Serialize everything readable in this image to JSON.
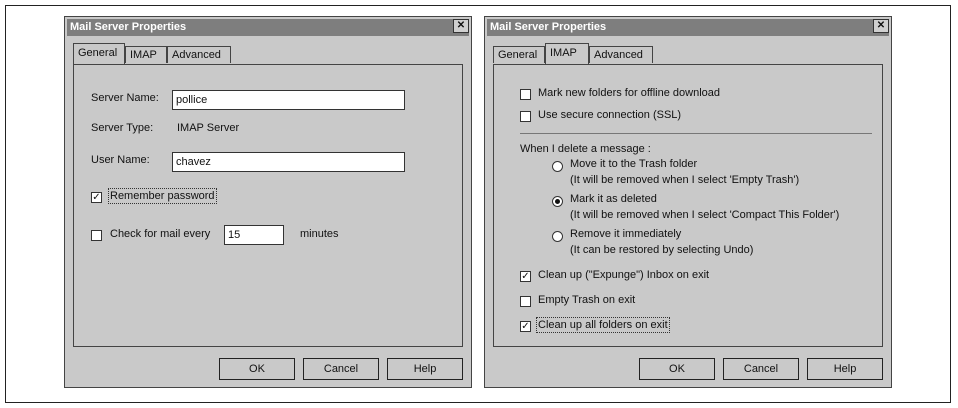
{
  "dialog_left": {
    "title": "Mail Server Properties",
    "close_glyph": "✕",
    "tabs": [
      "General",
      "IMAP",
      "Advanced"
    ],
    "server_name_label": "Server Name:",
    "server_name_value": "pollice",
    "server_type_label": "Server Type:",
    "server_type_value": "IMAP Server",
    "user_name_label": "User Name:",
    "user_name_value": "chavez",
    "remember_password_label": "Remember password",
    "remember_password_checked": true,
    "check_mail_label": "Check for mail every",
    "check_mail_checked": false,
    "check_mail_minutes": "15",
    "minutes_label": "minutes",
    "buttons": {
      "ok": "OK",
      "cancel": "Cancel",
      "help": "Help"
    }
  },
  "dialog_right": {
    "title": "Mail Server Properties",
    "close_glyph": "✕",
    "tabs": [
      "General",
      "IMAP",
      "Advanced"
    ],
    "mark_offline_label": "Mark new folders for offline download",
    "mark_offline_checked": false,
    "ssl_label": "Use secure connection (SSL)",
    "ssl_checked": false,
    "delete_heading": "When I delete a message :",
    "radio_trash_label": "Move it to the Trash folder",
    "radio_trash_note": "(It will be removed when I select 'Empty Trash')",
    "radio_mark_label": "Mark it as deleted",
    "radio_mark_note": "(It will be removed when I select 'Compact This Folder')",
    "radio_remove_label": "Remove it immediately",
    "radio_remove_note": "(It can be restored by selecting Undo)",
    "selected_radio": "mark",
    "expunge_label": "Clean up (\"Expunge\") Inbox on exit",
    "expunge_checked": true,
    "empty_trash_label": "Empty Trash on exit",
    "empty_trash_checked": false,
    "cleanup_all_label": "Clean up all folders on exit",
    "cleanup_all_checked": true,
    "buttons": {
      "ok": "OK",
      "cancel": "Cancel",
      "help": "Help"
    }
  },
  "checkmark_glyph": "✓"
}
